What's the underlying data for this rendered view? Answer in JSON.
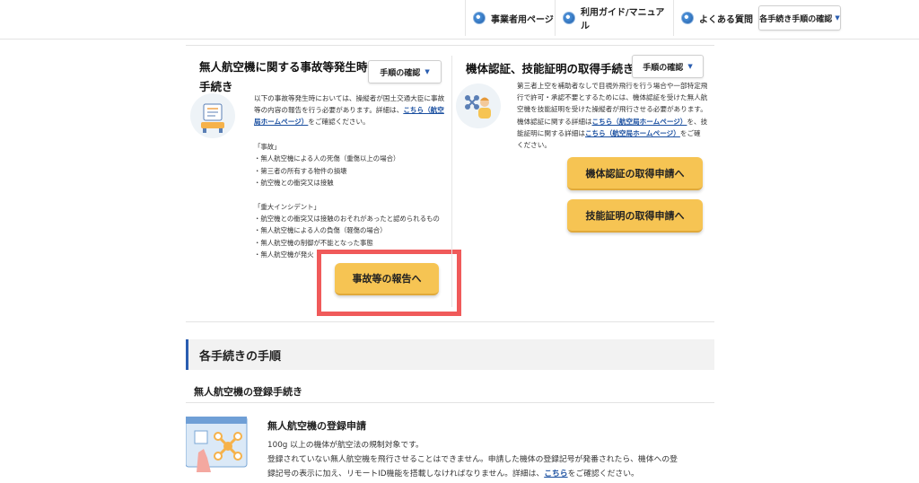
{
  "nav": {
    "items": [
      {
        "label": "事業者用ページ",
        "icon": "globe-icon"
      },
      {
        "label": "利用ガイド/マニュアル",
        "icon": "globe-icon"
      },
      {
        "label": "よくある質問",
        "icon": "globe-icon"
      }
    ],
    "select_label": "各手続き手順の確認"
  },
  "accident": {
    "title_line1": "無人航空機に関する事故等発生時の",
    "title_line2": "手続き",
    "step_button": "手順の確認",
    "desc_line1": "以下の事故等発生時においては、操縦者が国土交通大臣に事故",
    "desc_line2": "等の内容の報告を行う必要があります。詳細は、",
    "desc_link_a": "こちら（航空",
    "desc_link_b": "局ホームページ）",
    "desc_line3_tail": "をご確認ください。",
    "jiko_heading": "「事故」",
    "jiko_items": [
      "・無人航空機による人の死傷（重傷以上の場合）",
      "・第三者の所有する物件の損壊",
      "・航空機との衝突又は接触"
    ],
    "incident_heading": "「重大インシデント」",
    "incident_items": [
      "・航空機との衝突又は接触のおそれがあったと認められるもの",
      "・無人航空機による人の負傷（軽傷の場合）",
      "・無人航空機の制御が不能となった事態",
      "・無人航空機が発火"
    ],
    "report_button": "事故等の報告へ"
  },
  "certification": {
    "title": "機体認証、技能証明の取得手続き",
    "step_button": "手順の確認",
    "desc_line1": "第三者上空を補助者なしで目視外飛行を行う場合や一部特定飛",
    "desc_line2": "行で許可・承認不要とするためには、機体認証を受けた無人航",
    "desc_line3": "空機を技能証明を受けた操縦者が飛行させる必要があります。",
    "desc_line4_head": "機体認証に関する詳細は",
    "desc_line4_link": "こちら（航空局ホームページ）",
    "desc_line4_tail": "を、技",
    "desc_line5_head": "能証明に関する詳細は",
    "desc_line5_link": "こちら（航空局ホームページ）",
    "desc_line5_tail": "をご確",
    "desc_line6": "ください。",
    "btn_airframe": "機体認証の取得申請へ",
    "btn_skill": "技能証明の取得申請へ"
  },
  "procedures": {
    "heading": "各手続きの手順",
    "subheading": "無人航空機の登録手続き",
    "reg_title": "無人航空機の登録申請",
    "reg_line1": "100g 以上の機体が航空法の規制対象です。",
    "reg_line2": "登録されていない無人航空機を飛行させることはできません。申請した機体の登録記号が発番されたら、機体への登",
    "reg_line3_head": "録記号の表示に加え、リモートID機能を搭載しなければなりません。詳細は、",
    "reg_line3_link": "こちら",
    "reg_line3_tail": "をご確認ください。"
  },
  "colors": {
    "accent_blue": "#2a5db0",
    "button_yellow": "#f6c453",
    "highlight_red": "#f05a5a"
  }
}
